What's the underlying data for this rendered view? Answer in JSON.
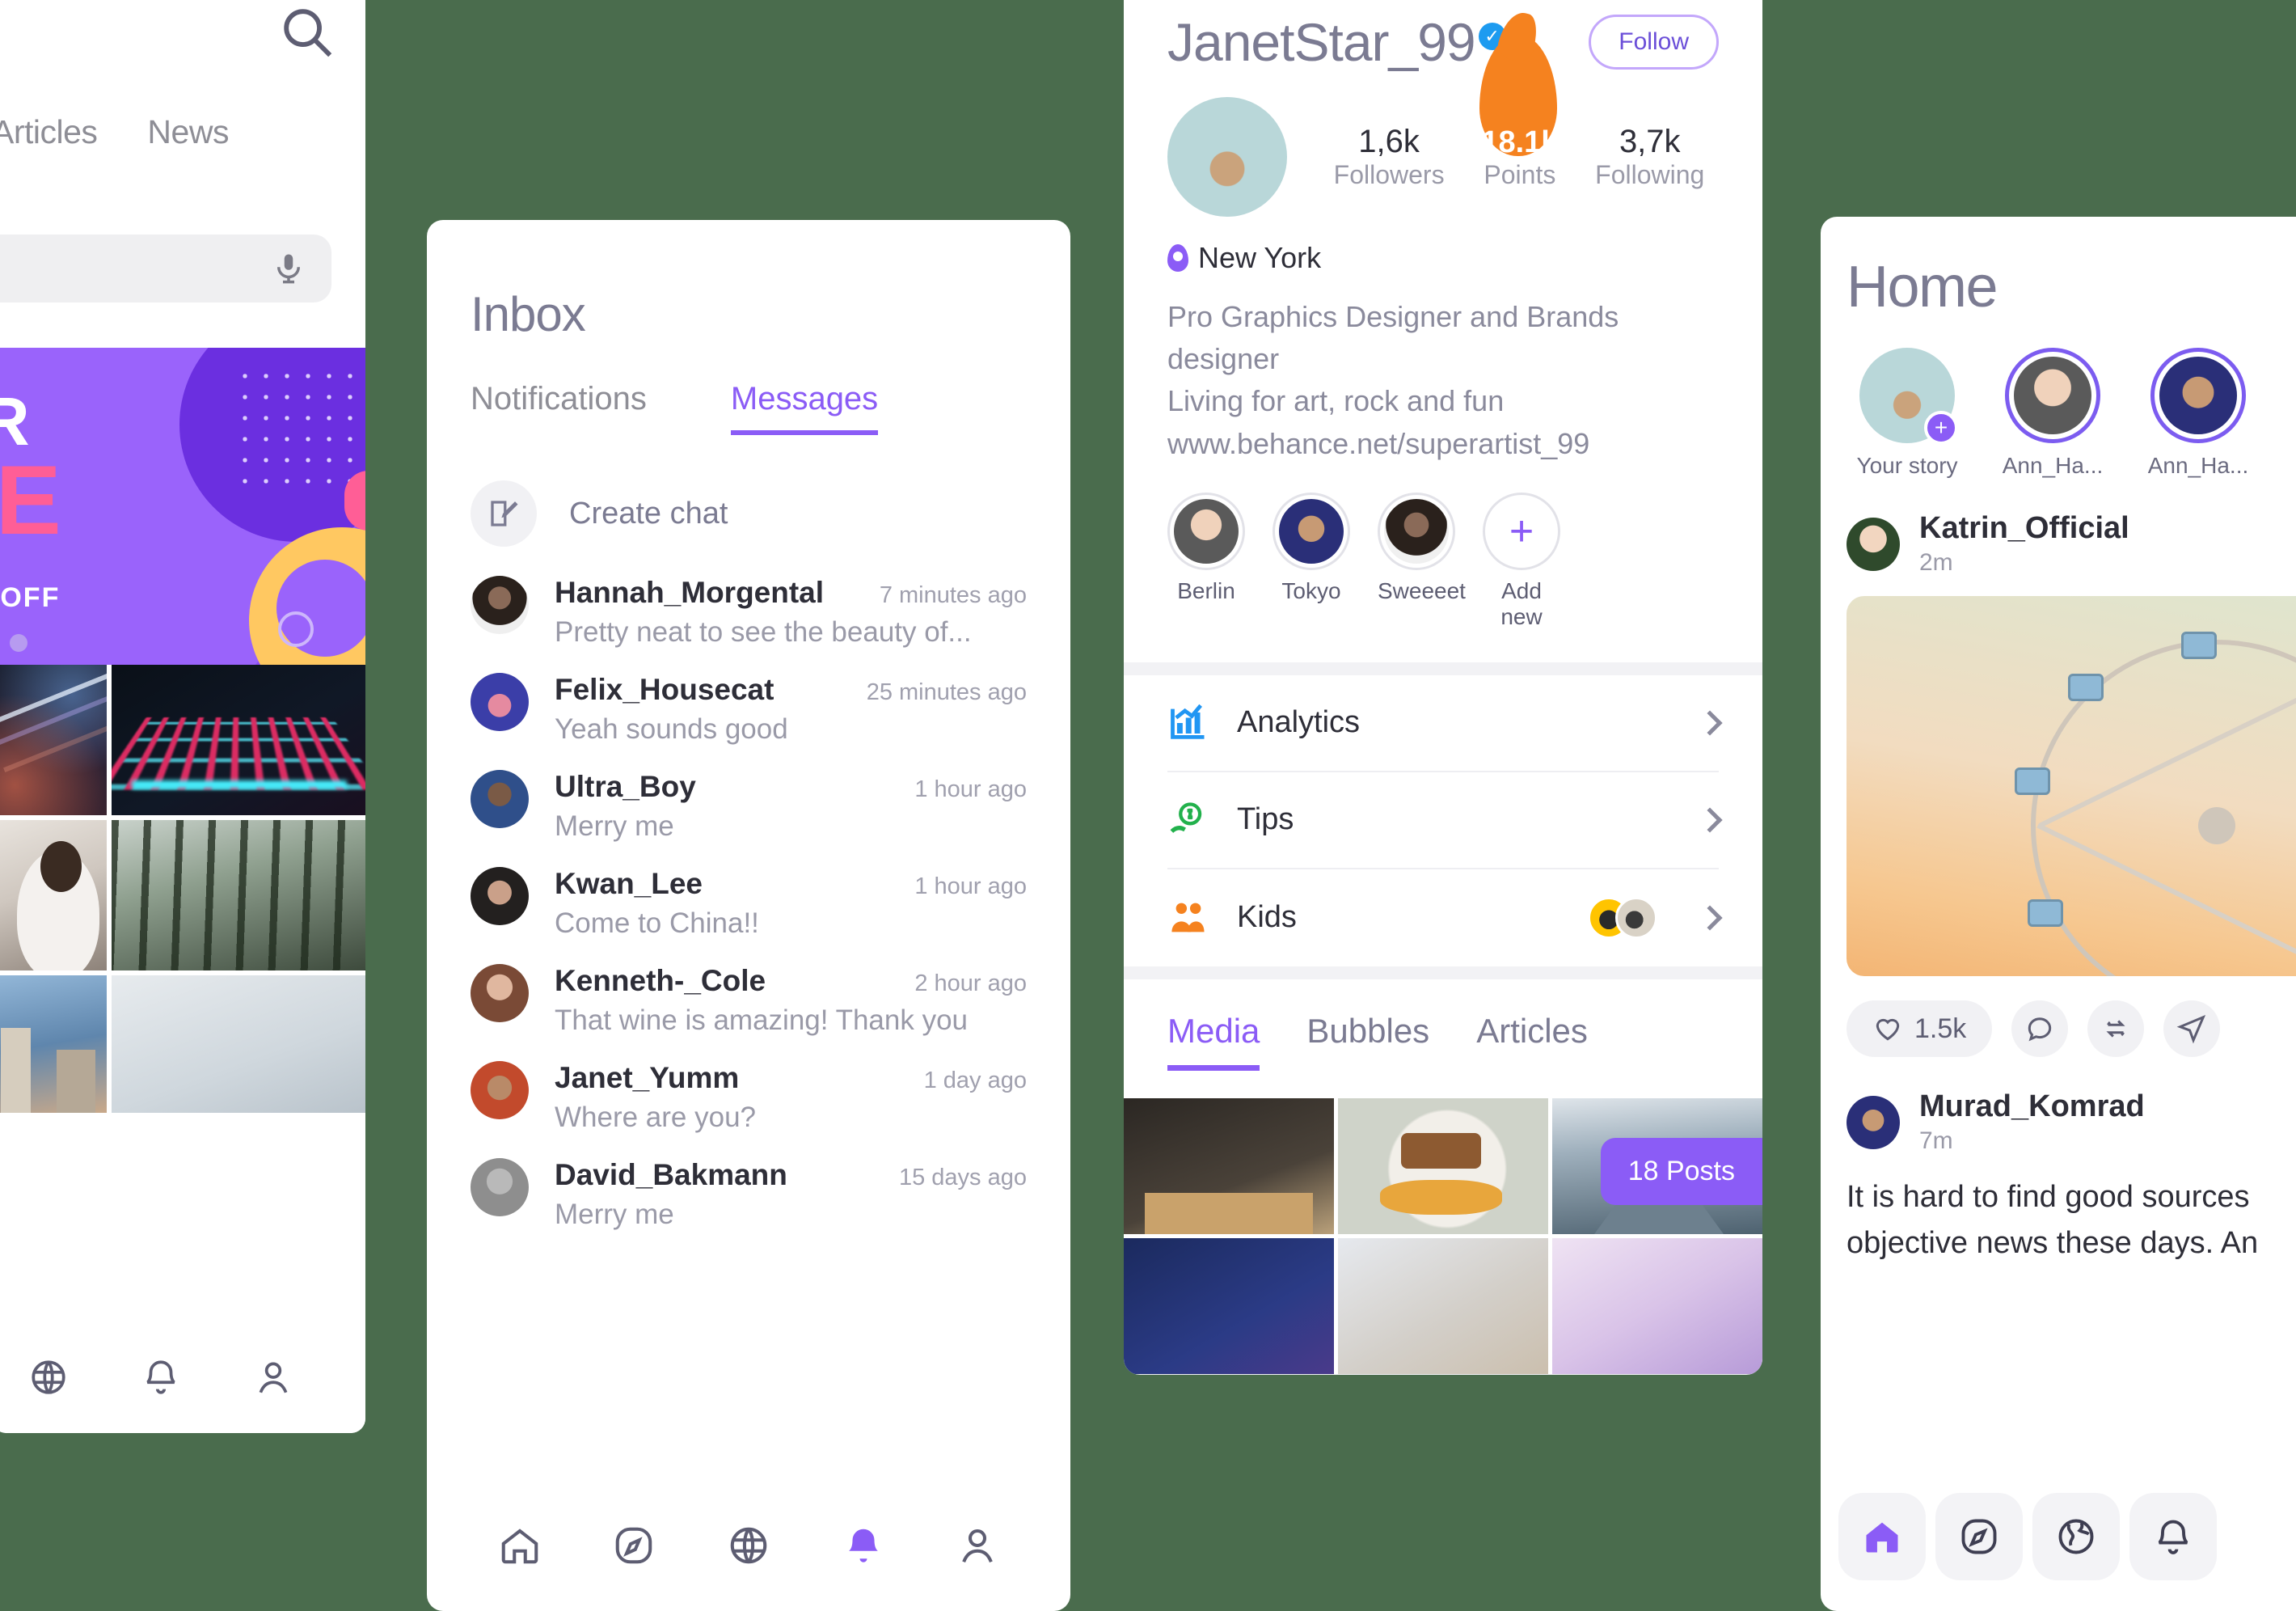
{
  "discover": {
    "tabs": [
      "Articles",
      "News"
    ],
    "search_placeholder": "",
    "icons": {
      "search": "search-icon",
      "mic": "microphone-icon"
    },
    "banner": {
      "line1": "ER",
      "line2": "LE",
      "percent": "%",
      "off": "OFF"
    },
    "nav": [
      "globe-icon",
      "bell-icon",
      "profile-icon"
    ]
  },
  "inbox": {
    "title": "Inbox",
    "tabs": [
      {
        "label": "Notifications",
        "active": false
      },
      {
        "label": "Messages",
        "active": true
      }
    ],
    "create_chat": "Create chat",
    "messages": [
      {
        "name": "Hannah_Morgental",
        "time": "7 minutes ago",
        "preview": "Pretty neat to see the beauty of..."
      },
      {
        "name": "Felix_Housecat",
        "time": "25 minutes ago",
        "preview": "Yeah sounds good"
      },
      {
        "name": "Ultra_Boy",
        "time": "1 hour ago",
        "preview": "Merry me"
      },
      {
        "name": "Kwan_Lee",
        "time": "1 hour ago",
        "preview": "Come to China!!"
      },
      {
        "name": "Kenneth-_Cole",
        "time": "2 hour ago",
        "preview": "That wine is amazing! Thank you"
      },
      {
        "name": "Janet_Yumm",
        "time": "1 day ago",
        "preview": "Where are you?"
      },
      {
        "name": "David_Bakmann",
        "time": "15 days ago",
        "preview": "Merry me"
      }
    ],
    "nav": [
      "home-icon",
      "compass-icon",
      "globe-icon",
      "bell-icon",
      "profile-icon"
    ],
    "nav_active": "bell-icon",
    "accent": "#8b5cf6"
  },
  "profile": {
    "username": "JanetStar_99",
    "verified": true,
    "follow_label": "Follow",
    "stats": [
      {
        "value": "1,6k",
        "label": "Followers"
      },
      {
        "value": "18.1k",
        "label": "Points"
      },
      {
        "value": "3,7k",
        "label": "Following"
      }
    ],
    "location": "New York",
    "bio": [
      "Pro Graphics Designer and Brands designer",
      "Living for art, rock and fun",
      "www.behance.net/superartist_99"
    ],
    "highlights": [
      {
        "label": "Berlin"
      },
      {
        "label": "Tokyo"
      },
      {
        "label": "Sweeeet"
      },
      {
        "label": "Add new"
      }
    ],
    "menu": [
      {
        "label": "Analytics",
        "icon": "bar-chart-icon"
      },
      {
        "label": "Tips",
        "icon": "money-hand-icon"
      },
      {
        "label": "Kids",
        "icon": "people-icon"
      }
    ],
    "content_tabs": [
      {
        "label": "Media",
        "active": true
      },
      {
        "label": "Bubbles",
        "active": false
      },
      {
        "label": "Articles",
        "active": false
      }
    ],
    "posts_badge": "18 Posts",
    "accent": "#8b5cf6",
    "points_color": "#f5821f"
  },
  "home": {
    "title": "Home",
    "stories": [
      {
        "label": "Your story",
        "has_add": true,
        "ring": false
      },
      {
        "label": "Ann_Ha...",
        "has_add": false,
        "ring": true
      },
      {
        "label": "Ann_Ha...",
        "has_add": false,
        "ring": true
      }
    ],
    "posts": [
      {
        "author": "Katrin_Official",
        "time": "2m",
        "likes": "1.5k",
        "has_image": true
      },
      {
        "author": "Murad_Komrad",
        "time": "7m",
        "text": "It is hard to find good sources objective news these days. An"
      }
    ],
    "actions": [
      "heart-icon",
      "comment-icon",
      "repost-icon",
      "share-icon"
    ],
    "nav": [
      "home-icon",
      "compass-icon",
      "globe-icon",
      "bell-icon"
    ],
    "nav_active": "home-icon",
    "accent": "#8b5cf6"
  }
}
